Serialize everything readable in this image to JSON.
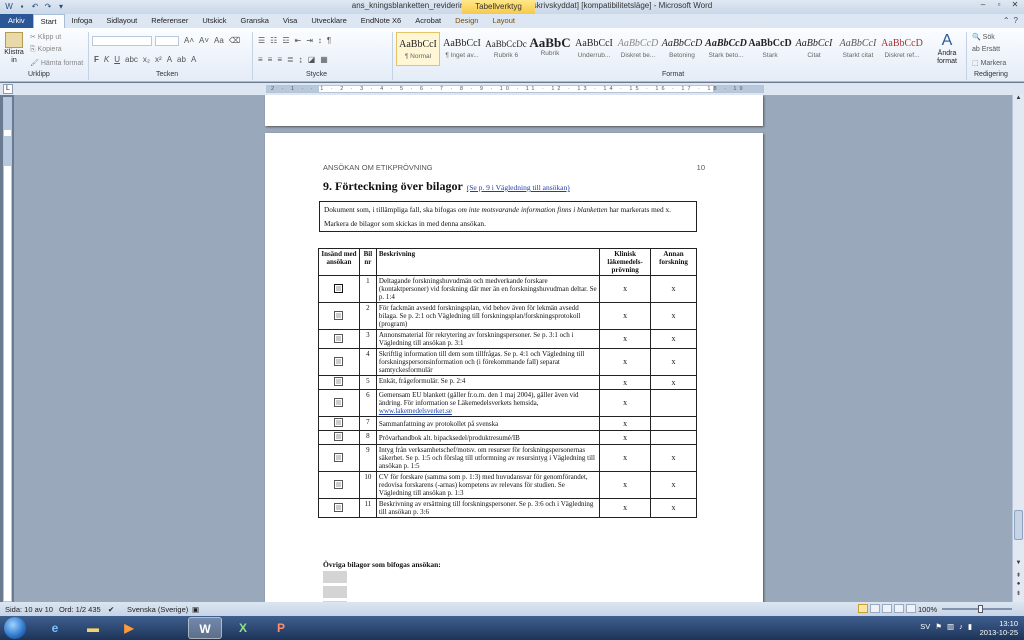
{
  "window": {
    "title": "ans_kningsblanketten_revidering_mars_2013.doc [skrivskyddat] [kompatibilitetsläge] - Microsoft Word",
    "context_tab_title": "Tabellverktyg"
  },
  "ribbon_tabs": [
    {
      "label": "Arkiv"
    },
    {
      "label": "Start"
    },
    {
      "label": "Infoga"
    },
    {
      "label": "Sidlayout"
    },
    {
      "label": "Referenser"
    },
    {
      "label": "Utskick"
    },
    {
      "label": "Granska"
    },
    {
      "label": "Visa"
    },
    {
      "label": "Utvecklare"
    },
    {
      "label": "EndNote X6"
    },
    {
      "label": "Acrobat"
    },
    {
      "label": "Design"
    },
    {
      "label": "Layout"
    }
  ],
  "clipboard": {
    "paste_label": "Klistra in",
    "cut": "Klipp ut",
    "copy": "Kopiera",
    "format_painter": "Hämta format",
    "group_label": "Urklipp"
  },
  "font": {
    "group_label": "Tecken",
    "bold": "F",
    "italic": "K",
    "underline": "U"
  },
  "paragraph": {
    "group_label": "Stycke"
  },
  "styles": {
    "group_label": "Format",
    "items": [
      {
        "sample": "AaBbCcI",
        "name": "¶ Normal"
      },
      {
        "sample": "AaBbCcI",
        "name": "¶ Inget av..."
      },
      {
        "sample": "AaBbCcDc",
        "name": "Rubrik 6"
      },
      {
        "sample": "AaBbC",
        "name": "Rubrik"
      },
      {
        "sample": "AaBbCcI",
        "name": "Underrub..."
      },
      {
        "sample": "AaBbCcD",
        "name": "Diskret be..."
      },
      {
        "sample": "AaBbCcD",
        "name": "Betoning"
      },
      {
        "sample": "AaBbCcD",
        "name": "Stark beto..."
      },
      {
        "sample": "AaBbCcD",
        "name": "Stark"
      },
      {
        "sample": "AaBbCcI",
        "name": "Citat"
      },
      {
        "sample": "AaBbCcI",
        "name": "Starkt citat"
      },
      {
        "sample": "AaBbCcD",
        "name": "Diskret ref..."
      }
    ],
    "change_label": "Ändra format"
  },
  "editing": {
    "find": "Sök",
    "replace": "Ersätt",
    "select": "Markera",
    "group_label": "Redigering"
  },
  "ruler": {
    "marks": "2 · 1 · · 1 · 2 · 3 · 4 · 5 · 6 · 7 · 8 · 9 · 10 · 11 · 12 · 13 · 14 · 15 · 16 · 17 · 18 · 19"
  },
  "document": {
    "header_left": "ANSÖKAN OM ETIKPRÖVNING",
    "header_right": "10",
    "heading": "9. Förteckning  över bilagor",
    "heading_link": "(Se p. 9 i Vägledning till ansökan)",
    "intro_1": "Dokument som, i tillämpliga fall, ska bifogas ",
    "intro_em": "om inte motsvarande information finns i blanketten",
    "intro_2": " har markerats med x. Markera de bilagor som skickas in med denna ansökan.",
    "table": {
      "headers": {
        "sent": "Insänd med ansökan",
        "num": "Bil nr",
        "desc": "Beskrivning",
        "clinical": "Klinisk läkemedels-prövning",
        "other": "Annan forskning"
      },
      "rows": [
        {
          "num": "1",
          "desc": "Deltagande forskningshuvudmän och medverkande forskare (kontaktpersoner) vid forskning där mer än en forskningshuvudman deltar. Se p. 1:4",
          "clinical": "x",
          "other": "x"
        },
        {
          "num": "2",
          "desc": "För fackmän avsedd forskningsplan, vid behov även för lekmän avsedd bilaga. Se p. 2:1 och Vägledning till forskningsplan/forskningsprotokoll (program)",
          "clinical": "x",
          "other": "x"
        },
        {
          "num": "3",
          "desc": "Annonsmaterial för rekrytering av forskningspersoner.  Se p. 3:1 och i Vägledning till ansökan p. 3:1",
          "clinical": "x",
          "other": "x"
        },
        {
          "num": "4",
          "desc": "Skriftlig information till dem som tillfrågas. Se p. 4:1 och Vägledning till forskningspersonsinformation och (i förekommande fall) separat samtyckesformulär",
          "clinical": "x",
          "other": "x"
        },
        {
          "num": "5",
          "desc": "Enkät, frågeformulär. Se p. 2:4",
          "clinical": "x",
          "other": "x"
        },
        {
          "num": "6",
          "desc": "Gemensam EU blankett (gäller fr.o.m. den 1 maj 2004), gäller även vid ändring. För information se Läkemedelsverkets hemsida,",
          "link": "www.lakemedelsverket.se",
          "clinical": "x",
          "other": ""
        },
        {
          "num": "7",
          "desc": "Sammanfattning av protokollet på svenska",
          "clinical": "x",
          "other": ""
        },
        {
          "num": "8",
          "desc": "Prövarhandbok alt. bipacksedel/produktresumé/IB",
          "clinical": "x",
          "other": ""
        },
        {
          "num": "9",
          "desc": "Intyg från verksamhetschef/motsv. om resurser för forskningspersonernas säkerhet. Se p. 1:5 och förslag till utformning av resursintyg i Vägledning till ansökan p. 1:5",
          "clinical": "x",
          "other": "x"
        },
        {
          "num": "10",
          "desc": "CV för forskare (samma som p. 1:3) med huvudansvar för genomförandet, redovisa forskarens (-arnas) kompetens av relevans för studien. Se Vägledning till ansökan p. 1:3",
          "clinical": "x",
          "other": "x"
        },
        {
          "num": "11",
          "desc": "Beskrivning av ersättning till forskningspersoner. Se p. 3:6 och i Vägledning till ansökan p. 3:6",
          "clinical": "x",
          "other": "x"
        }
      ]
    },
    "other_attachments": "Övriga bilagor som bifogas ansökan:"
  },
  "statusbar": {
    "page": "Sida: 10 av 10",
    "words": "Ord: 1/2 435",
    "language": "Svenska (Sverige)",
    "zoom": "100%"
  },
  "taskbar": {
    "lang": "SV",
    "time": "13:10",
    "date": "2013-10-25"
  }
}
